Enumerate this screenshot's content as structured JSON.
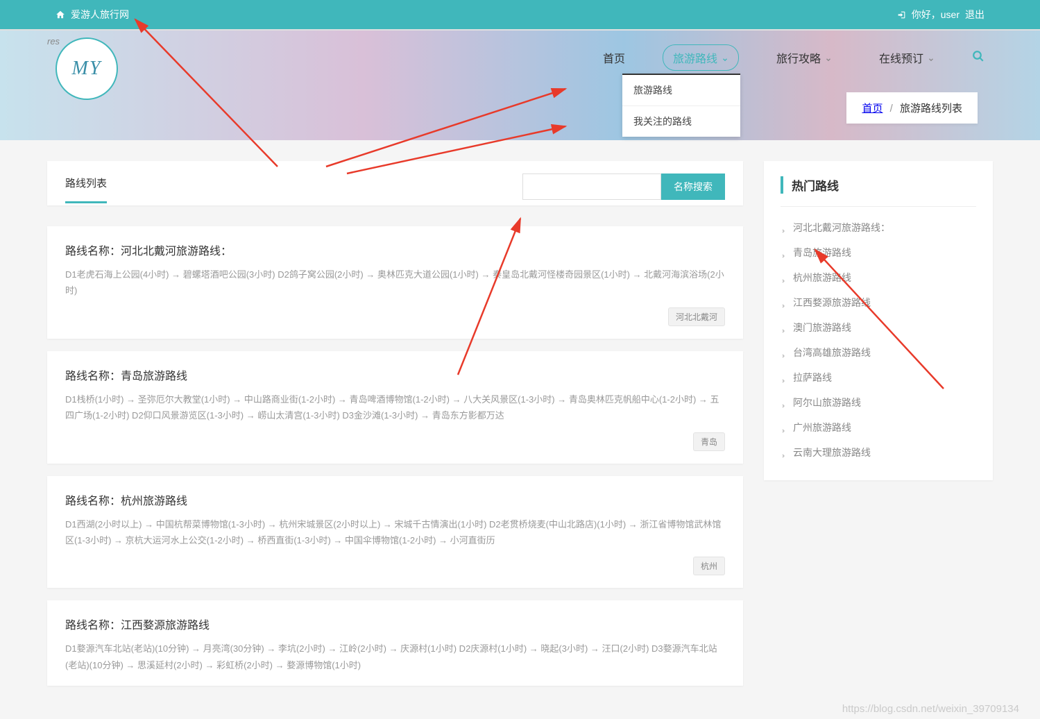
{
  "topbar": {
    "site_name": "爱游人旅行网",
    "greeting": "你好，user",
    "logout": "退出"
  },
  "header": {
    "logo_text": "MY",
    "res_text": "res",
    "nav": [
      {
        "label": "首页"
      },
      {
        "label": "旅游路线"
      },
      {
        "label": "旅行攻略"
      },
      {
        "label": "在线预订"
      }
    ],
    "dropdown": [
      {
        "label": "旅游路线"
      },
      {
        "label": "我关注的路线"
      }
    ]
  },
  "breadcrumb": {
    "home": "首页",
    "current": "旅游路线列表"
  },
  "list": {
    "tab_title": "路线列表",
    "search_btn": "名称搜索",
    "title_prefix": "路线名称：",
    "routes": [
      {
        "name": "河北北戴河旅游路线：",
        "desc": "D1老虎石海上公园(4小时) → 碧螺塔酒吧公园(3小时) D2鸽子窝公园(2小时) → 奥林匹克大道公园(1小时) → 秦皇岛北戴河怪楼奇园景区(1小时) → 北戴河海滨浴场(2小时)",
        "tag": "河北北戴河"
      },
      {
        "name": "青岛旅游路线",
        "desc": "D1栈桥(1小时) → 圣弥厄尔大教堂(1小时) → 中山路商业街(1-2小时) → 青岛啤酒博物馆(1-2小时) → 八大关风景区(1-3小时) → 青岛奥林匹克帆船中心(1-2小时) → 五四广场(1-2小时) D2仰口风景游览区(1-3小时) → 崂山太清宫(1-3小时) D3金沙滩(1-3小时) → 青岛东方影都万达",
        "tag": "青岛"
      },
      {
        "name": "杭州旅游路线",
        "desc": "D1西湖(2小时以上) → 中国杭帮菜博物馆(1-3小时) → 杭州宋城景区(2小时以上) → 宋城千古情演出(1小时) D2老贯桥烧麦(中山北路店)(1小时) → 浙江省博物馆武林馆区(1-3小时) → 京杭大运河水上公交(1-2小时) → 桥西直街(1-3小时) → 中国伞博物馆(1-2小时) → 小河直街历",
        "tag": "杭州"
      },
      {
        "name": "江西婺源旅游路线",
        "desc": "D1婺源汽车北站(老站)(10分钟) → 月亮湾(30分钟) → 李坑(2小时) → 江岭(2小时) → 庆源村(1小时) D2庆源村(1小时) → 晓起(3小时) → 汪口(2小时) D3婺源汽车北站(老站)(10分钟) → 思溪延村(2小时) → 彩虹桥(2小时) → 婺源博物馆(1小时)",
        "tag": ""
      }
    ]
  },
  "sidebar": {
    "title": "热门路线",
    "items": [
      "河北北戴河旅游路线：",
      "青岛旅游路线",
      "杭州旅游路线",
      "江西婺源旅游路线",
      "澳门旅游路线",
      "台湾高雄旅游路线",
      "拉萨路线",
      "阿尔山旅游路线",
      "广州旅游路线",
      "云南大理旅游路线"
    ]
  },
  "watermark": "https://blog.csdn.net/weixin_39709134"
}
